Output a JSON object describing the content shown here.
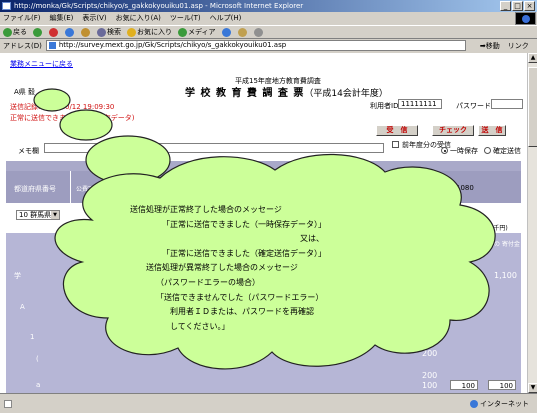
{
  "window": {
    "title": "http://monka/Gk/Scripts/chikyo/s_gakkokyouiku01.asp - Microsoft Internet Explorer",
    "controls": [
      "_",
      "□",
      "×"
    ]
  },
  "menu": [
    "ファイル(F)",
    "編集(E)",
    "表示(V)",
    "お気に入り(A)",
    "ツール(T)",
    "ヘルプ(H)"
  ],
  "toolbar": {
    "back": "戻る",
    "search": "検索",
    "favorites": "お気に入り",
    "media": "メディア"
  },
  "address": {
    "label": "アドレス(D)",
    "url": "http://survey.mext.go.jp/Gk/Scripts/chikyo/s_gakkokyouiku01.asp",
    "go": "移動",
    "links": "リンク"
  },
  "page": {
    "back_link": "業務メニューに戻る",
    "user_name": "A県 毅",
    "subtitle": "平成15年度地方教育費調査",
    "title": "学 校 教 育 費 調 査 票",
    "fiscal_year": "（平成14会計年度）",
    "user_id_label": "利用者ID",
    "user_id_value": "11111111",
    "password_label": "パスワード",
    "sent_time": "送信記録:2004/10/12 19:09:30",
    "sent_status": "正常に送信できました(一時保存データ)",
    "buttons": {
      "receive": "受　信",
      "check": "チェック",
      "send": "送　信"
    },
    "memo_label": "メモ欄",
    "prev_label": "前年度分の受信",
    "radio_temp": "一時保存",
    "radio_final": "確定送信",
    "table": {
      "band_text": "日",
      "head_pref": "都道府県番号",
      "head_pub": "公費？",
      "head_code": "1080",
      "pref_select": "10 群馬県",
      "unit": "(単位:千円)",
      "right_col": "その他の\n寄付金",
      "row_labels": [
        "学",
        "A",
        "1",
        "(",
        "a"
      ],
      "values": [
        "1,100",
        "200",
        "200",
        "100",
        "100",
        "100"
      ]
    }
  },
  "status": {
    "zone": "インターネット"
  },
  "balloon": {
    "lines": [
      "送信処理が正常終了した場合のメッセージ",
      "「正常に送信できました（一時保存データ）」",
      "又は、",
      "「正常に送信できました（確定送信データ）」",
      "送信処理が異常終了した場合のメッセージ",
      "（パスワードエラーの場合）",
      "「送信できませんでした（パスワードエラー）",
      "利用者ＩＤまたは、パスワードを再確認",
      "してください。」"
    ]
  }
}
